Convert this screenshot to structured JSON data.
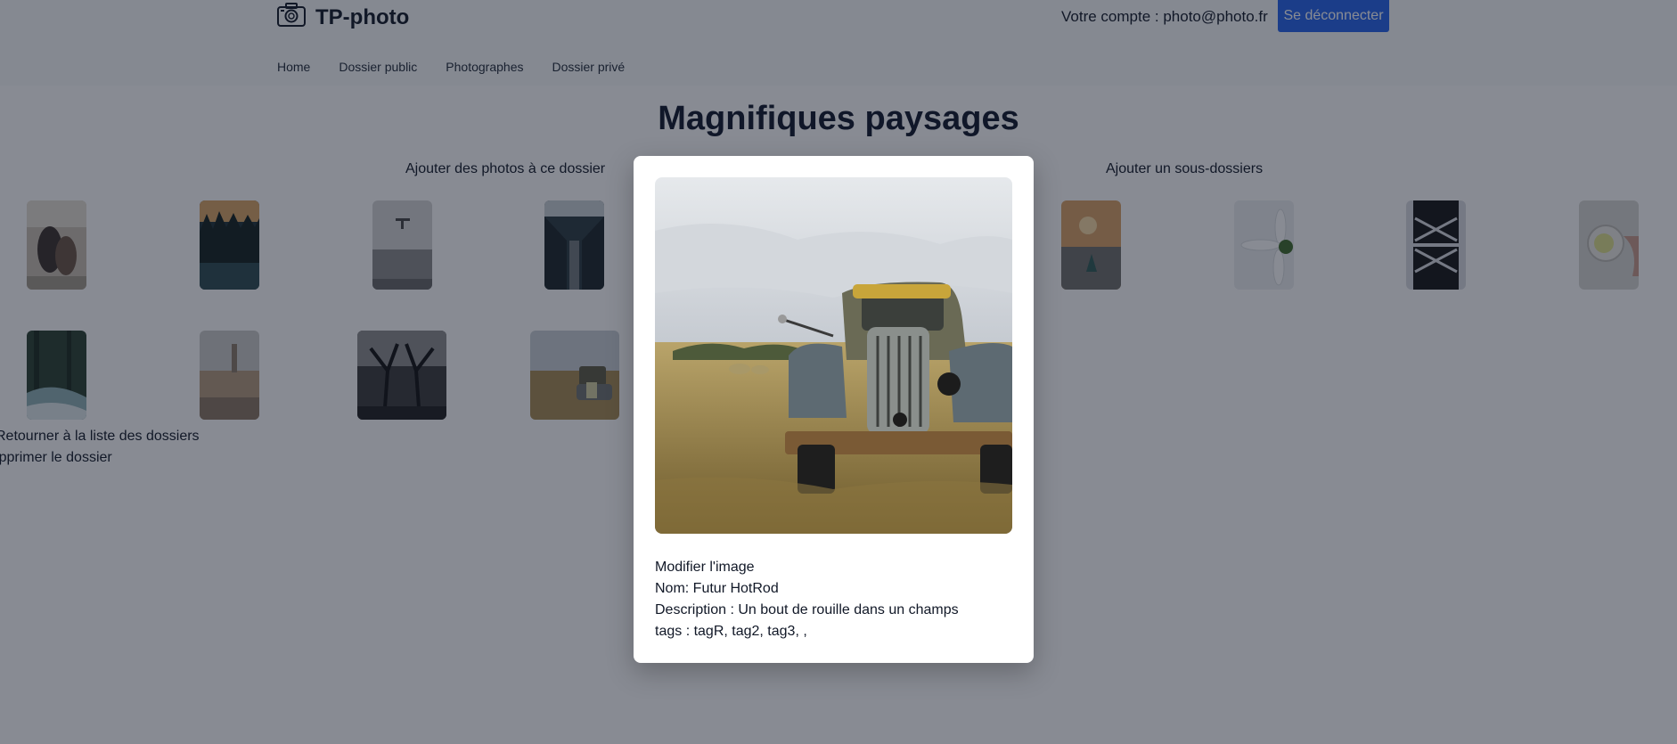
{
  "header": {
    "brand": "TP-photo",
    "account_text": "Votre compte : photo@photo.fr",
    "logout_label": "Se déconnecter",
    "nav": [
      "Home",
      "Dossier public",
      "Photographes",
      "Dossier privé"
    ]
  },
  "folder": {
    "title": "Magnifiques paysages",
    "add_photos_label": "Ajouter des photos à ce dossier",
    "add_subfolder_label": "Ajouter un sous-dossiers",
    "back_label": "Retourner à la liste des dossiers",
    "delete_label": "Supprimer le dossier"
  },
  "thumbnails": [
    "couple-photo",
    "forest-photo",
    "wall-photo",
    "escalator-photo",
    "beach-photo",
    "daisy-photo",
    "tower-photo",
    "lemon-cup-photo",
    "waterfall-photo",
    "city-photo",
    "dark-trees-photo",
    "old-truck-photo"
  ],
  "modal": {
    "edit_label": "Modifier l'image",
    "name_line": "Nom: Futur HotRod",
    "description_line": "Description : Un bout de rouille dans un champs",
    "tags_line": "tags : tagR, tag2, tag3, ,"
  },
  "colors": {
    "overlay": "#111827",
    "logout_button": "#2563eb"
  }
}
